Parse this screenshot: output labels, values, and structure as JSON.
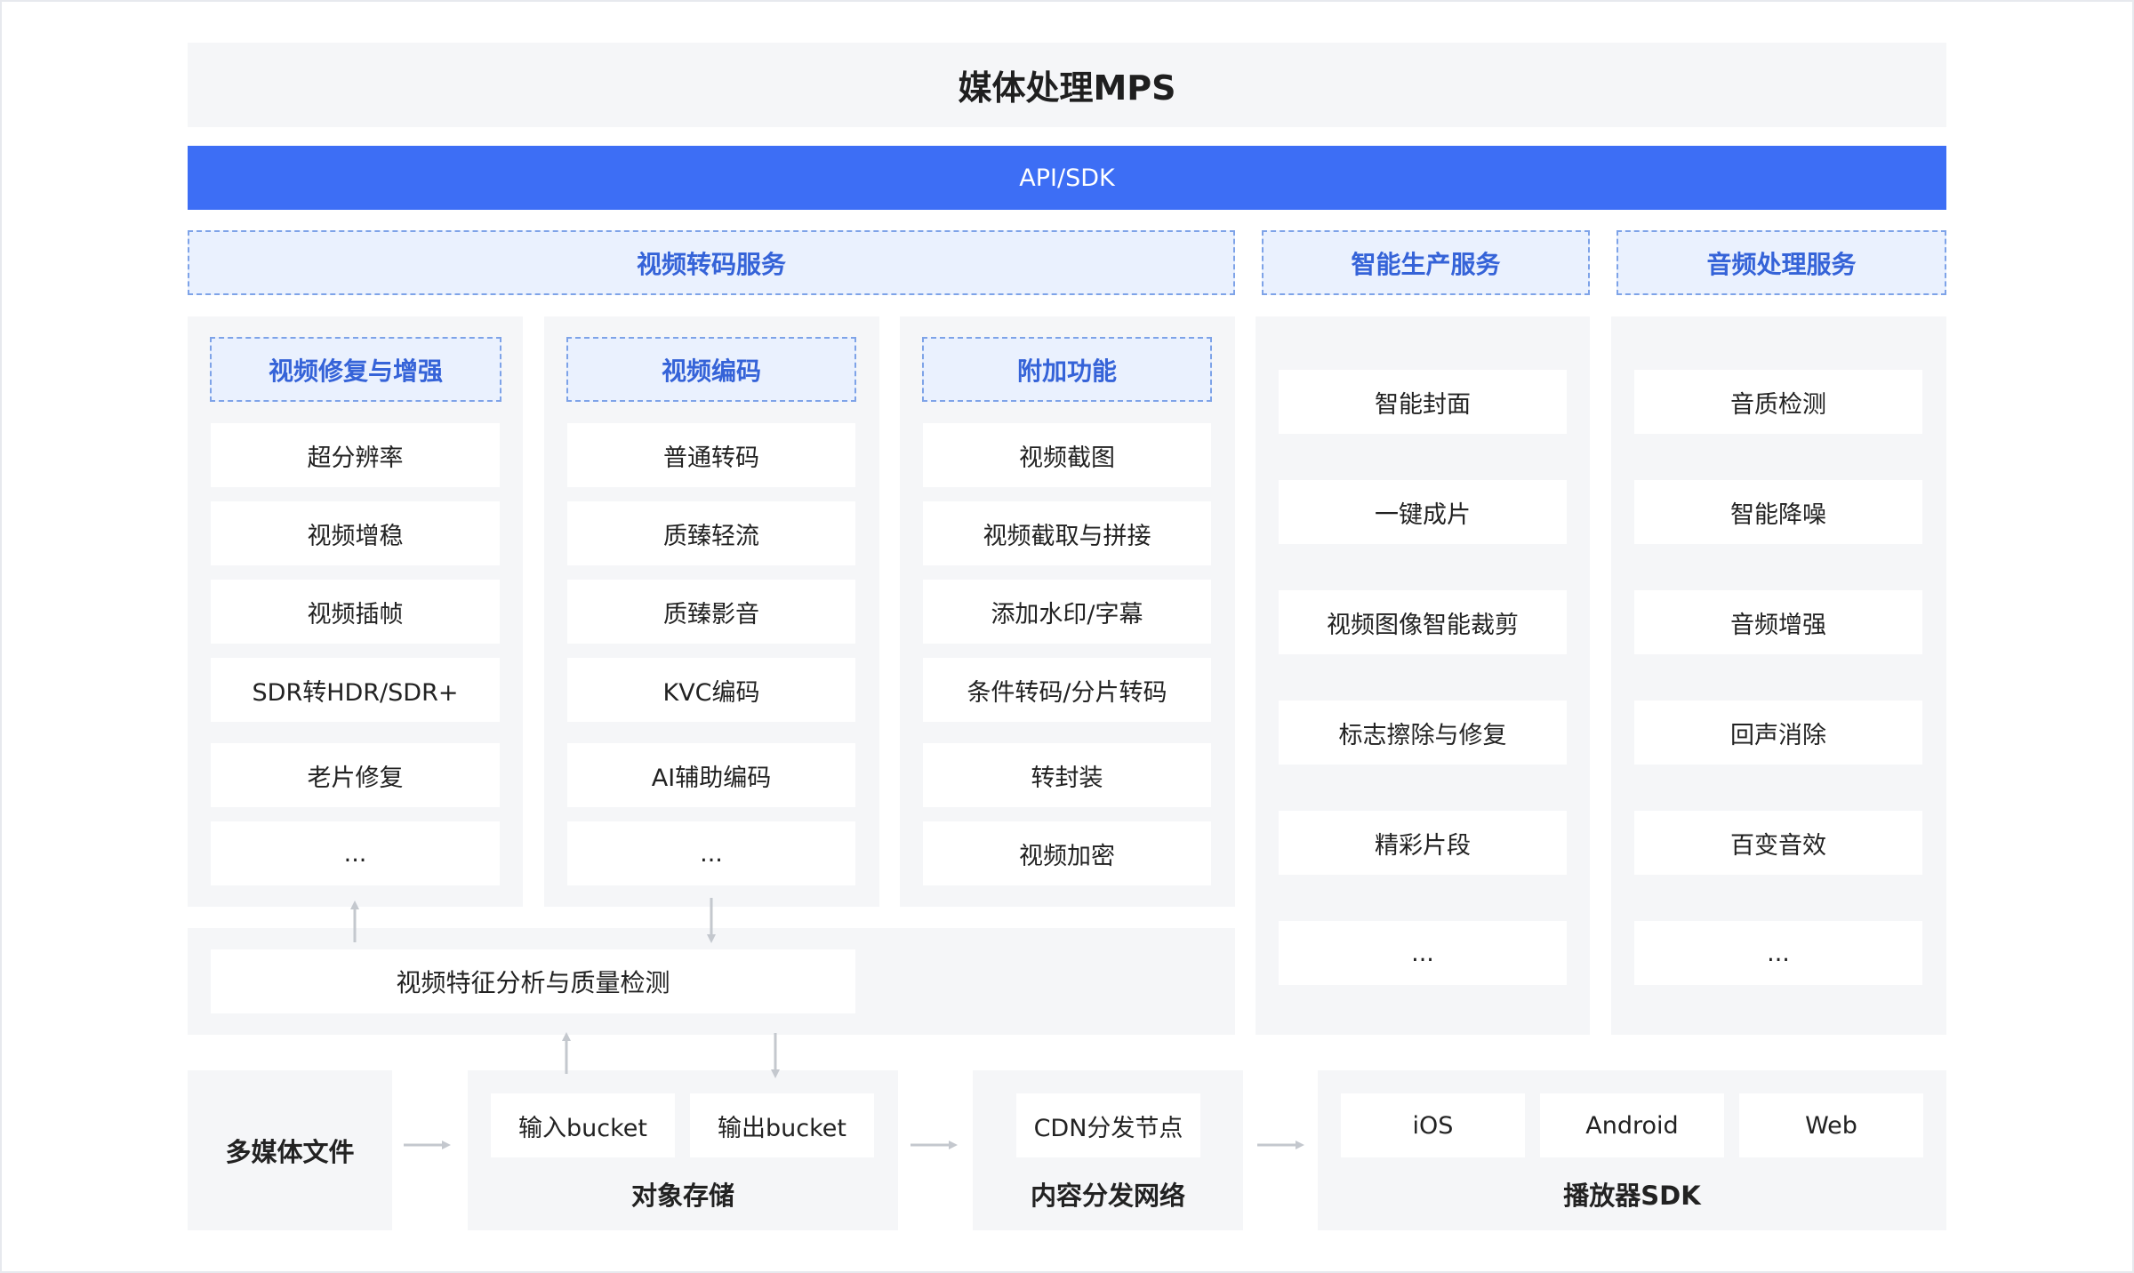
{
  "title": "媒体处理MPS",
  "api": "API/SDK",
  "services": {
    "transcode": "视频转码服务",
    "smart": "智能生产服务",
    "audio": "音频处理服务"
  },
  "enhance": {
    "header": "视频修复与增强",
    "items": [
      "超分辨率",
      "视频增稳",
      "视频插帧",
      "SDR转HDR/SDR+",
      "老片修复",
      "..."
    ]
  },
  "encode": {
    "header": "视频编码",
    "items": [
      "普通转码",
      "质臻轻流",
      "质臻影音",
      "KVC编码",
      "AI辅助编码",
      "..."
    ]
  },
  "extra": {
    "header": "附加功能",
    "items": [
      "视频截图",
      "视频截取与拼接",
      "添加水印/字幕",
      "条件转码/分片转码",
      "转封装",
      "视频加密"
    ]
  },
  "smart_items": [
    "智能封面",
    "一键成片",
    "视频图像智能裁剪",
    "标志擦除与修复",
    "精彩片段",
    "..."
  ],
  "audio_items": [
    "音质检测",
    "智能降噪",
    "音频增强",
    "回声消除",
    "百变音效",
    "..."
  ],
  "analysis": "视频特征分析与质量检测",
  "bottom": {
    "media_files": "多媒体文件",
    "storage_label": "对象存储",
    "input_bucket": "输入bucket",
    "output_bucket": "输出bucket",
    "cdn_label": "内容分发网络",
    "cdn_node": "CDN分发节点",
    "player_label": "播放器SDK",
    "platforms": [
      "iOS",
      "Android",
      "Web"
    ]
  },
  "colors": {
    "accent": "#3d6ef5",
    "header_bg": "#eaf1fe",
    "header_text": "#3563d8",
    "panel_bg": "#f5f6f8",
    "arrow": "#c4c8ce"
  }
}
